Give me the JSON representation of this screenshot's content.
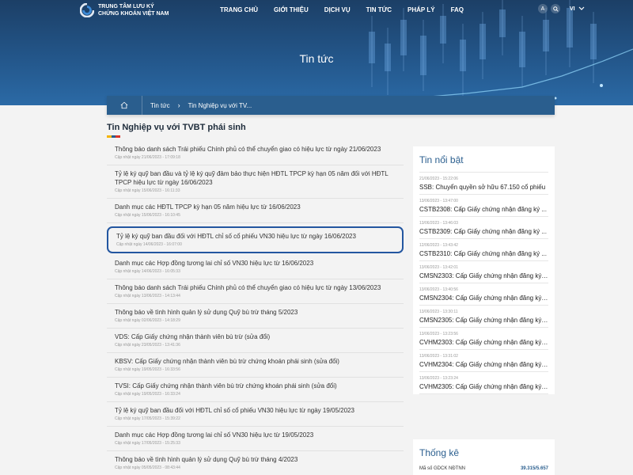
{
  "header": {
    "logo_line1": "TRUNG TÂM LƯU KÝ",
    "logo_line2": "CHỨNG KHOÁN VIỆT NAM",
    "nav": [
      "TRANG CHỦ",
      "GIỚI THIỆU",
      "DỊCH VỤ",
      "TIN TỨC",
      "PHÁP LÝ",
      "FAQ"
    ],
    "font_button": "A",
    "lang": "VI",
    "title": "Tin tức"
  },
  "breadcrumb": {
    "items": [
      "Tin tức",
      "Tin Nghiệp vụ với TV..."
    ]
  },
  "section": {
    "title": "Tin Nghiệp vụ với TVBT phái sinh",
    "underline_colors": [
      "#f4b400",
      "#2a5e8e",
      "#d9342b"
    ]
  },
  "news": [
    {
      "title": "Thông báo danh sách Trái phiếu Chính phủ có thể chuyển giao có hiệu lực từ ngày 21/06/2023",
      "date": "Cập nhật ngày 21/06/2023 - 17:09:18"
    },
    {
      "title": "Tỷ lệ ký quỹ ban đầu và tỷ lệ ký quỹ đảm bảo thực hiện HĐTL TPCP kỳ hạn 05 năm đối với HĐTL TPCP hiệu lực từ ngày 16/06/2023",
      "date": "Cập nhật ngày 15/06/2023 - 16:11:33"
    },
    {
      "title": "Danh mục các HĐTL TPCP kỳ hạn 05 năm hiệu lực từ 16/06/2023",
      "date": "Cập nhật ngày 15/06/2023 - 16:10:45"
    },
    {
      "title": "Tỷ lệ ký quỹ ban đầu đối với HĐTL chỉ số cổ phiếu VN30 hiệu lực từ ngày 16/06/2023",
      "date": "Cập nhật ngày 14/06/2023 - 16:07:00"
    },
    {
      "title": "Danh mục các Hợp đồng tương lai chỉ số VN30 hiệu lực từ 16/06/2023",
      "date": "Cập nhật ngày 14/06/2023 - 16:05:33"
    },
    {
      "title": "Thông báo danh sách Trái phiếu Chính phủ có thể chuyển giao có hiệu lực từ ngày 13/06/2023",
      "date": "Cập nhật ngày 13/06/2023 - 14:13:44"
    },
    {
      "title": "Thông báo về tình hình quản lý sử dụng Quỹ bù trừ tháng 5/2023",
      "date": "Cập nhật ngày 02/06/2023 - 14:18:29"
    },
    {
      "title": "VDS: Cấp Giấy chứng nhận thành viên bù trừ (sửa đổi)",
      "date": "Cập nhật ngày 23/05/2023 - 13:41:36"
    },
    {
      "title": "KBSV: Cấp Giấy chứng nhận thành viên bù trừ chứng khoán phái sinh (sửa đổi)",
      "date": "Cập nhật ngày 19/05/2023 - 16:33:56"
    },
    {
      "title": "TVSI: Cấp Giấy chứng nhận thành viên bù trừ chứng khoán phái sinh (sửa đổi)",
      "date": "Cập nhật ngày 19/05/2023 - 16:33:24"
    },
    {
      "title": "Tỷ lệ ký quỹ ban đầu đối với HĐTL chỉ số cổ phiếu VN30 hiệu lực từ ngày 19/05/2023",
      "date": "Cập nhật ngày 17/05/2023 - 15:39:22"
    },
    {
      "title": "Danh mục các Hợp đồng tương lai chỉ số VN30 hiệu lực từ 19/05/2023",
      "date": "Cập nhật ngày 17/05/2023 - 15:25:33"
    },
    {
      "title": "Thông báo về tình hình quản lý sử dụng Quỹ bù trừ tháng 4/2023",
      "date": "Cập nhật ngày 05/05/2023 - 08:43:44"
    }
  ],
  "sidebar": {
    "title": "Tin nổi bật",
    "items": [
      {
        "date": "21/06/2023 - 15:22:06",
        "title": "SSB: Chuyển quyền sở hữu 67.150 cổ phiếu"
      },
      {
        "date": "13/06/2023 - 13:47:00",
        "title": "CSTB2308: Cấp Giấy chứng nhận đăng ký ..."
      },
      {
        "date": "13/06/2023 - 13:46:03",
        "title": "CSTB2309: Cấp Giấy chứng nhận đăng ký ..."
      },
      {
        "date": "12/06/2023 - 13:43:42",
        "title": "CSTB2310: Cấp Giấy chứng nhận đăng ký ..."
      },
      {
        "date": "13/06/2023 - 13:42:01",
        "title": "CMSN2303: Cấp Giấy chứng nhận đăng ký ..."
      },
      {
        "date": "13/06/2023 - 13:40:56",
        "title": "CMSN2304: Cấp Giấy chứng nhận đăng ký ..."
      },
      {
        "date": "13/06/2023 - 13:30:11",
        "title": "CMSN2305: Cấp Giấy chứng nhận đăng ký ..."
      },
      {
        "date": "13/06/2023 - 13:23:56",
        "title": "CVHM2303: Cấp Giấy chứng nhận đăng ký ..."
      },
      {
        "date": "13/06/2023 - 13:31:02",
        "title": "CVHM2304: Cấp Giấy chứng nhận đăng ký ..."
      },
      {
        "date": "13/06/2023 - 13:23:24",
        "title": "CVHM2305: Cấp Giấy chứng nhận đăng ký ..."
      }
    ]
  },
  "stats": {
    "title": "Thống kê",
    "row_label": "Mã số GDCK NĐTNN",
    "row_value": "39.315/5.657"
  }
}
